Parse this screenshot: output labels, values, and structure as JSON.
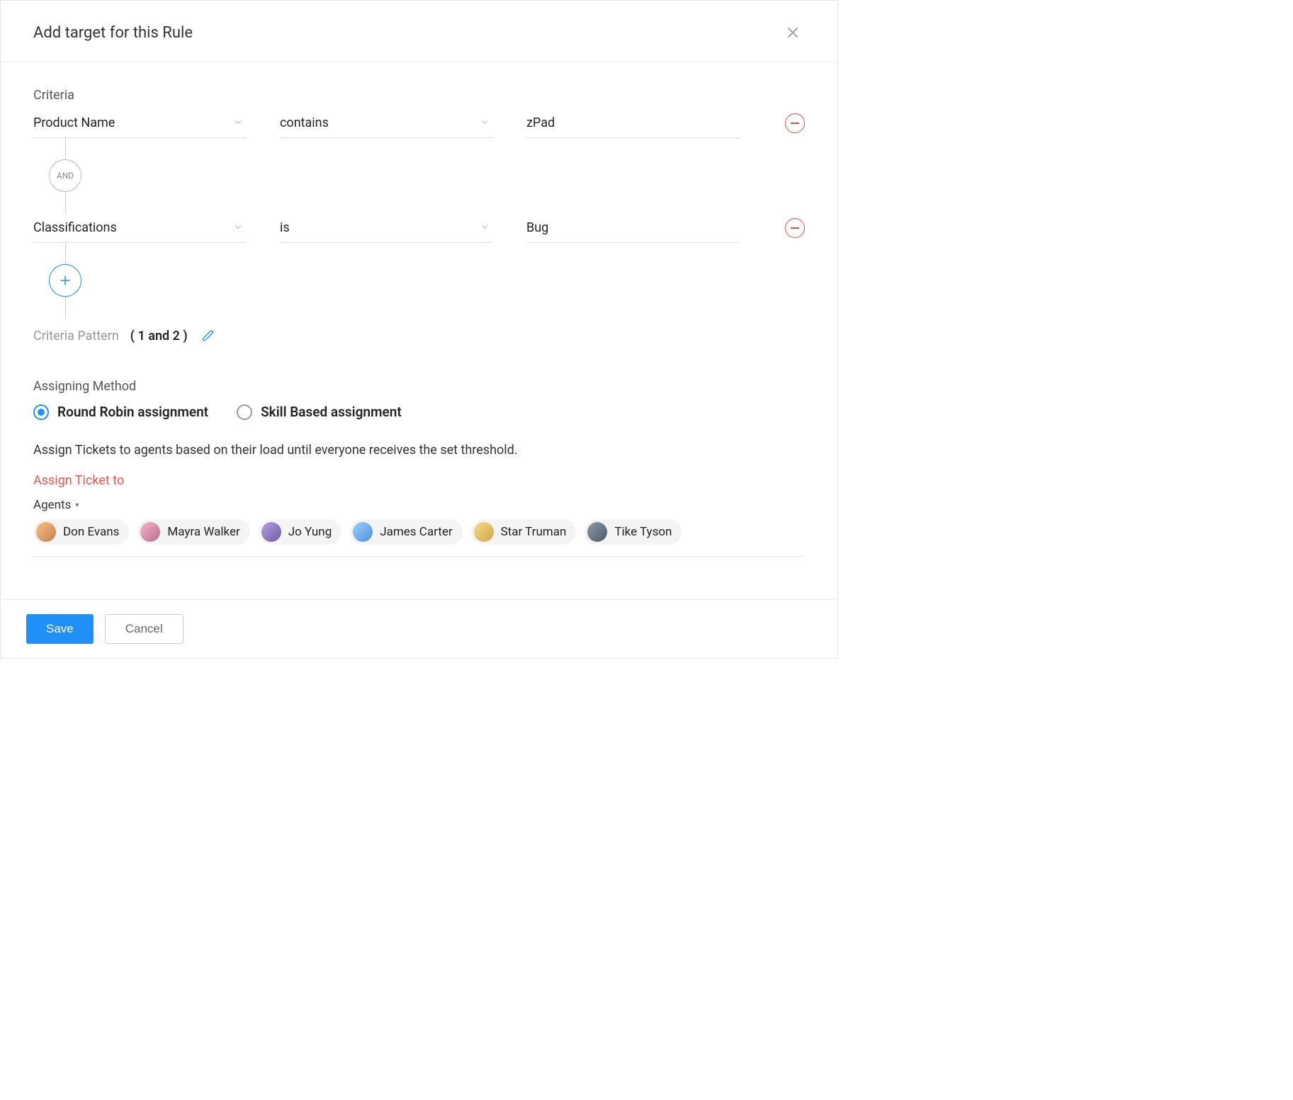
{
  "header": {
    "title": "Add target for this Rule"
  },
  "criteria": {
    "section_label": "Criteria",
    "rows": [
      {
        "field": "Product Name",
        "operator": "contains",
        "value": "zPad"
      },
      {
        "field": "Classifications",
        "operator": "is",
        "value": "Bug"
      }
    ],
    "connector": "AND",
    "pattern_label": "Criteria Pattern",
    "pattern_value": "( 1 and 2 )"
  },
  "assigning": {
    "section_label": "Assigning Method",
    "options": [
      {
        "label": "Round Robin assignment",
        "selected": true
      },
      {
        "label": "Skill Based assignment",
        "selected": false
      }
    ],
    "help_text": "Assign Tickets to agents based on their load until everyone receives the set threshold.",
    "target_label": "Assign Ticket to",
    "dropdown_label": "Agents",
    "agents": [
      {
        "name": "Don Evans"
      },
      {
        "name": "Mayra Walker"
      },
      {
        "name": "Jo Yung"
      },
      {
        "name": "James Carter"
      },
      {
        "name": "Star Truman"
      },
      {
        "name": "Tike Tyson"
      }
    ]
  },
  "footer": {
    "save": "Save",
    "cancel": "Cancel"
  }
}
